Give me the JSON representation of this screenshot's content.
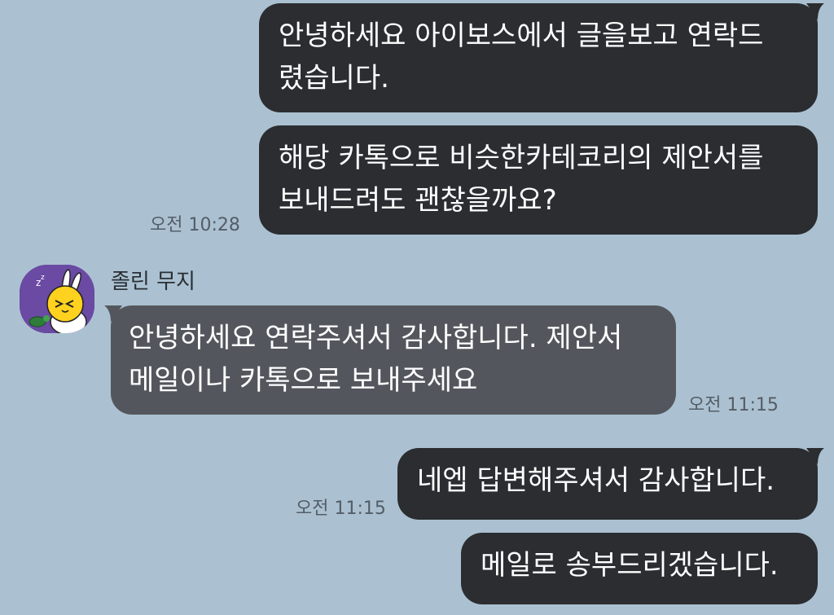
{
  "messages": [
    {
      "lines": [
        "안녕하세요 아이보스에서 글을보고 연락드",
        "렸습니다."
      ]
    },
    {
      "lines": [
        "해당 카톡으로 비슷한카테코리의 제안서를",
        "보내드려도 괜찮을까요?"
      ],
      "time": "오전 10:28"
    },
    {
      "sender": "졸린 무지",
      "lines": [
        "안녕하세요 연락주셔서 감사합니다. 제안서",
        "메일이나 카톡으로 보내주세요"
      ],
      "time": "오전 11:15"
    },
    {
      "lines": [
        "네엡 답변해주셔서 감사합니다."
      ],
      "time": "오전 11:15"
    },
    {
      "lines": [
        "메일로 송부드리겠습니다."
      ]
    }
  ],
  "colors": {
    "background": "#abc1d1",
    "my_bubble": "#2b2d31",
    "their_bubble": "#53575d",
    "time_text": "#545d66"
  },
  "avatar_icon": "sleepy-muzi-avatar-icon"
}
